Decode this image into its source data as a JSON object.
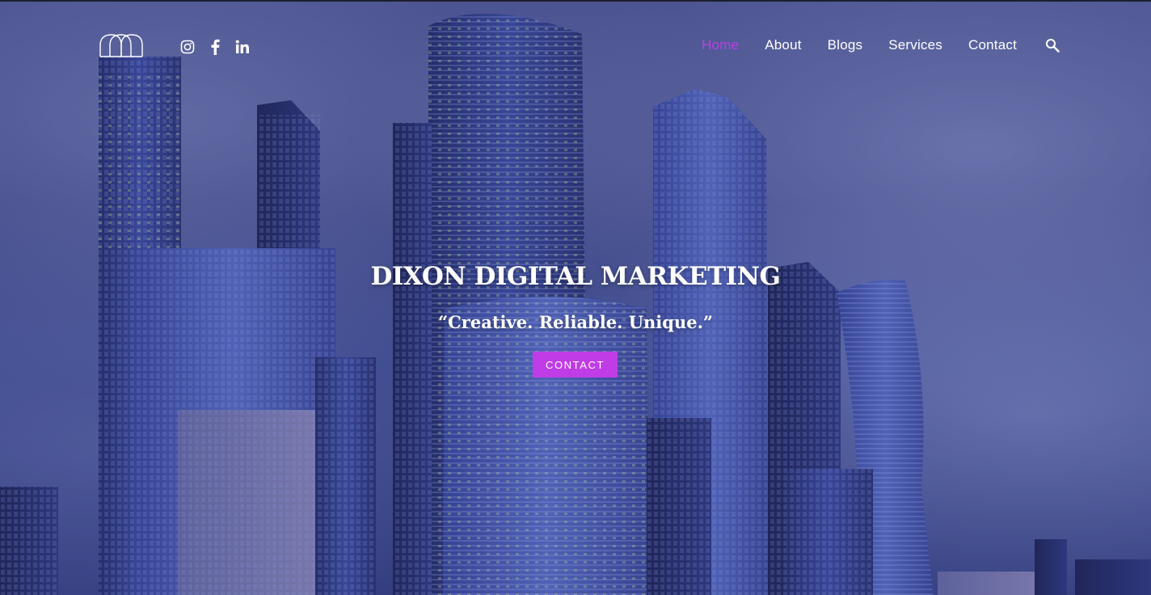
{
  "brand": {
    "logo_icon": "twin-arch-logo-icon",
    "accent_color": "#c03ce6"
  },
  "social": [
    {
      "icon": "instagram-icon"
    },
    {
      "icon": "facebook-icon"
    },
    {
      "icon": "linkedin-icon"
    }
  ],
  "nav": {
    "items": [
      {
        "label": "Home",
        "active": true
      },
      {
        "label": "About"
      },
      {
        "label": "Blogs"
      },
      {
        "label": "Services"
      },
      {
        "label": "Contact"
      }
    ],
    "search_icon": "search-icon"
  },
  "hero": {
    "title": "DIXON DIGITAL MARKETING",
    "tagline": "“Creative. Reliable. Unique.”",
    "cta_label": "CONTACT"
  }
}
